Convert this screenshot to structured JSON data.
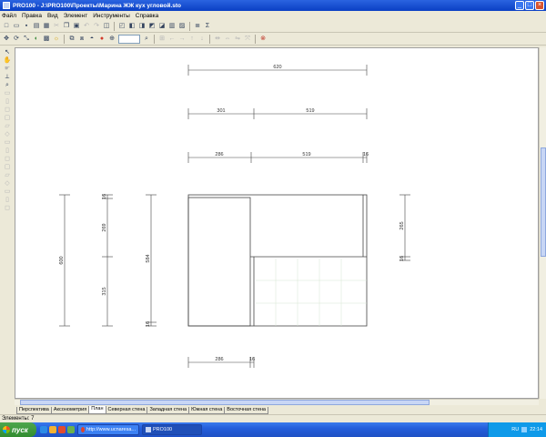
{
  "window": {
    "title": "PRO100 - J:\\PRO100\\Проекты\\Марина ЖЖ кух угловой.sto"
  },
  "menu": [
    "Файл",
    "Правка",
    "Вид",
    "Элемент",
    "Инструменты",
    "Справка"
  ],
  "toolbar1": [
    "new-icon",
    "open-icon",
    "save-icon",
    "print-preview-icon",
    "print-icon",
    "cut-icon",
    "copy-icon",
    "paste-icon",
    "undo-icon",
    "redo-icon",
    "element-icon",
    "sep",
    "room-icon",
    "front-view-icon",
    "left-view-icon",
    "right-view-icon",
    "back-view-icon",
    "bottom-view-icon",
    "top-view-icon",
    "sep",
    "list-icon",
    "sum-icon"
  ],
  "toolbar2": [
    "move-icon",
    "rotate-icon",
    "scale-icon",
    "color-icon",
    "texture-icon",
    "light-icon",
    "sep",
    "group-icon",
    "ungroup-icon",
    "shadow-icon",
    "red-icon",
    "zoom-in-icon",
    "zoom-field",
    "zoom-icon",
    "sep",
    "align-icon",
    "arrow-left-icon",
    "arrow-right-icon",
    "arrow-up-icon",
    "arrow-down-icon",
    "sep",
    "distribute-icon",
    "stretch-icon",
    "mirror-icon",
    "spread-icon",
    "sep",
    "stop-icon"
  ],
  "lefttools": [
    "pointer-icon",
    "hand-icon",
    "hand2-icon",
    "measure-icon",
    "zoom-icon",
    "tool6-icon",
    "tool7-icon",
    "tool8-icon",
    "tool9-icon",
    "tool10-icon",
    "tool11-icon",
    "tool12-icon",
    "tool13-icon",
    "tool14-icon",
    "tool15-icon",
    "tool16-icon",
    "tool17-icon",
    "tool18-icon",
    "tool19-icon",
    "tool20-icon"
  ],
  "tabs": [
    "Перспектива",
    "Аксонометрия",
    "План",
    "Северная стена",
    "Западная стена",
    "Южная стена",
    "Восточная стена"
  ],
  "active_tab": "План",
  "status": "Элементы: 7",
  "taskbar": {
    "start": "пуск",
    "items": [
      "http://www.ucnaresa...",
      "PRO100"
    ],
    "lang": "RU",
    "clock": "22:14"
  },
  "drawing": {
    "dim_total": "620",
    "dim_a": "301",
    "dim_b": "519",
    "dim_c": "286",
    "dim_d": "519",
    "dim_e": "16",
    "dim_left_total": "600",
    "dim_left_top": "16",
    "dim_left_mid": "269",
    "dim_left_bottom": "315",
    "dim_left2": "584",
    "dim_left2_bottom": "16",
    "dim_right": "265",
    "dim_right_bottom": "16",
    "dim_bottom_a": "286",
    "dim_bottom_b": "16"
  }
}
